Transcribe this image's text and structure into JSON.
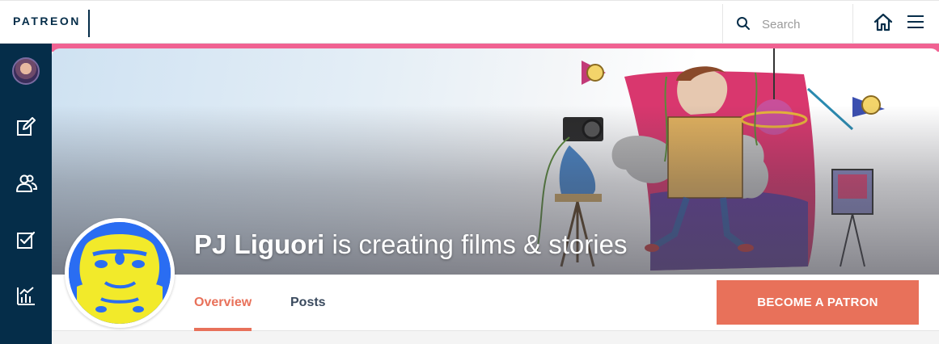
{
  "app": {
    "brand": "PATREON",
    "brand_color": "#052d49"
  },
  "header": {
    "search_placeholder": "Search",
    "search_value": "",
    "icons": [
      "search-icon",
      "home-icon",
      "hamburger-menu-icon"
    ]
  },
  "sidebar": {
    "items": [
      {
        "name": "account-avatar"
      },
      {
        "name": "edit-icon"
      },
      {
        "name": "people-icon"
      },
      {
        "name": "checklist-icon"
      },
      {
        "name": "analytics-icon"
      }
    ]
  },
  "creator": {
    "name": "PJ Liguori",
    "tagline": " is creating films & stories"
  },
  "tabs": [
    {
      "label": "Overview",
      "active": true
    },
    {
      "label": "Posts",
      "active": false
    }
  ],
  "cta": {
    "label": "BECOME A PATRON",
    "color": "#e8715a"
  },
  "colors": {
    "accent": "#e8715a",
    "strip": "#f06292",
    "sidebar": "#052d49"
  }
}
